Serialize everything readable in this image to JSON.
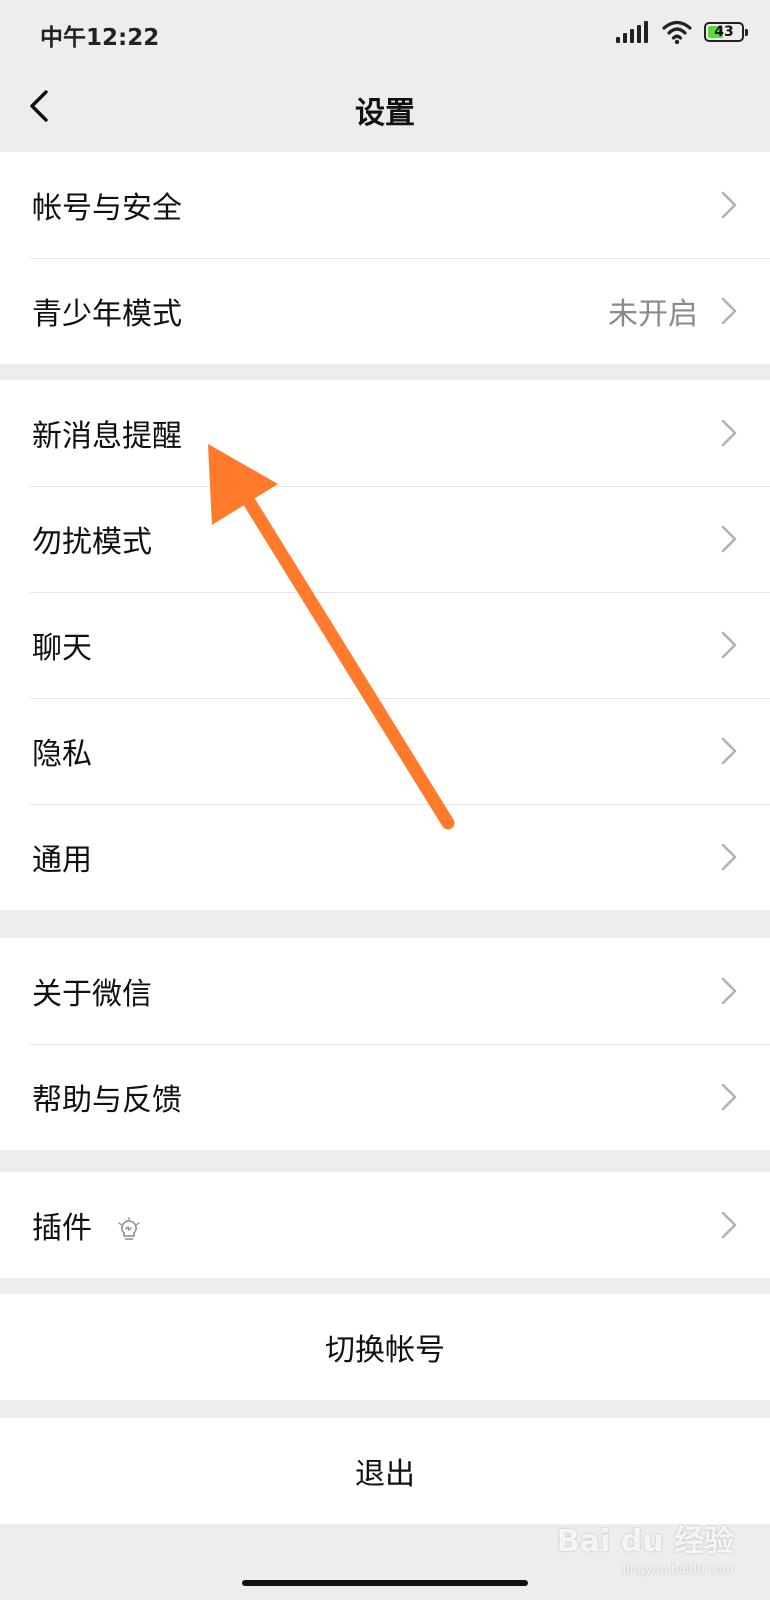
{
  "status_bar": {
    "time": "中午12:22",
    "battery_level": "43"
  },
  "nav": {
    "title": "设置",
    "back_icon": "chevron-left-icon"
  },
  "groups": [
    {
      "items": [
        {
          "label": "帐号与安全",
          "value": ""
        },
        {
          "label": "青少年模式",
          "value": "未开启"
        }
      ]
    },
    {
      "items": [
        {
          "label": "新消息提醒",
          "value": ""
        },
        {
          "label": "勿扰模式",
          "value": ""
        },
        {
          "label": "聊天",
          "value": ""
        },
        {
          "label": "隐私",
          "value": ""
        },
        {
          "label": "通用",
          "value": ""
        }
      ]
    },
    {
      "items": [
        {
          "label": "关于微信",
          "value": ""
        },
        {
          "label": "帮助与反馈",
          "value": ""
        }
      ]
    },
    {
      "items": [
        {
          "label": "插件",
          "value": "",
          "extra_icon": "lightbulb-icon"
        }
      ]
    }
  ],
  "actions": {
    "switch_account": "切换帐号",
    "logout": "退出"
  },
  "watermark": {
    "main": "Bai du 经验",
    "sub": "jingyan.baidu.com"
  },
  "colors": {
    "background": "#ededed",
    "annotation_arrow": "#ff7a2b"
  }
}
